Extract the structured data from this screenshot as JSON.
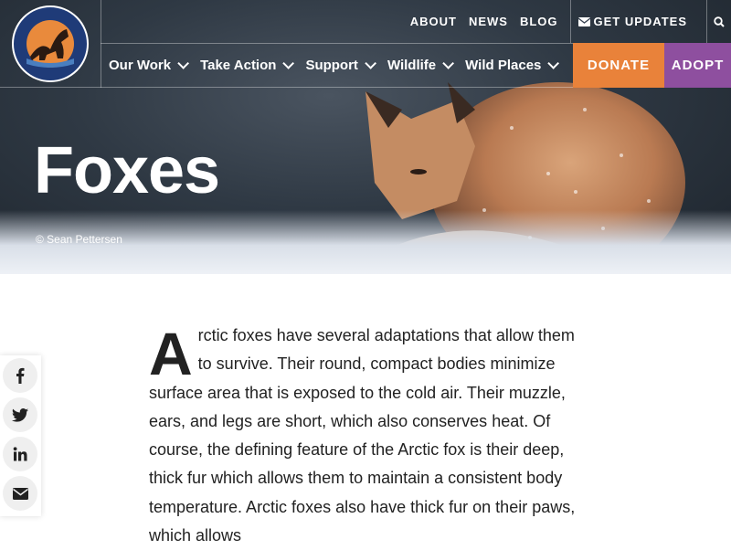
{
  "header": {
    "logo_text_top": "DEFENDERS",
    "logo_text_bottom": "OF WILDLIFE",
    "utility": {
      "about": "ABOUT",
      "news": "NEWS",
      "blog": "BLOG",
      "get_updates": "GET UPDATES",
      "updates_icon": "envelope-icon",
      "search_icon": "search-icon"
    },
    "nav": [
      {
        "label": "Our Work"
      },
      {
        "label": "Take Action"
      },
      {
        "label": "Support"
      },
      {
        "label": "Wildlife"
      },
      {
        "label": "Wild Places"
      }
    ],
    "donate": "DONATE",
    "adopt": "ADOPT",
    "colors": {
      "donate": "#e9823a",
      "adopt": "#8e4f9f"
    }
  },
  "hero": {
    "title": "Foxes",
    "credit": "© Sean Pettersen"
  },
  "article": {
    "dropcap": "A",
    "text": "rctic foxes have several adaptations that allow them to survive. Their round, compact bodies minimize surface area that is exposed to the cold air. Their muzzle, ears, and legs are short, which also conserves heat. Of course, the defining feature of the Arctic fox is their deep, thick fur which allows them to maintain a consistent body temperature. Arctic foxes also have thick fur on their paws, which allows"
  },
  "share": {
    "icons": [
      "facebook-icon",
      "twitter-icon",
      "linkedin-icon",
      "email-icon"
    ]
  }
}
